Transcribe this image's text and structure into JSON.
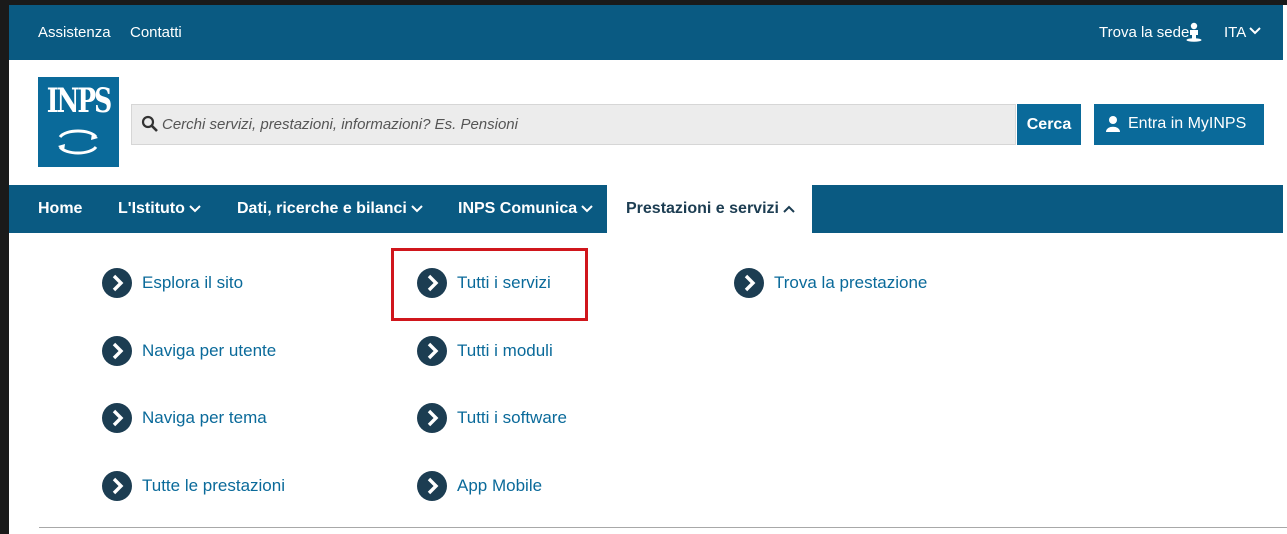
{
  "topbar": {
    "assistenza": "Assistenza",
    "contatti": "Contatti",
    "trova_sede": "Trova la sede",
    "lang": "ITA"
  },
  "header": {
    "logo_text": "INPS",
    "search_placeholder": "Cerchi servizi, prestazioni, informazioni? Es. Pensioni",
    "search_button": "Cerca",
    "login_button": "Entra in MyINPS"
  },
  "nav": {
    "home": "Home",
    "istituto": "L'Istituto",
    "dati": "Dati, ricerche e bilanci",
    "comunica": "INPS Comunica",
    "prestazioni": "Prestazioni e servizi"
  },
  "submenu": {
    "col1": [
      "Esplora il sito",
      "Naviga per utente",
      "Naviga per tema",
      "Tutte le prestazioni"
    ],
    "col2": [
      "Tutti i servizi",
      "Tutti i moduli",
      "Tutti i software",
      "App Mobile"
    ],
    "col3": [
      "Trova la prestazione"
    ]
  },
  "colors": {
    "brand": "#0a5a82",
    "accent": "#0a6a9a",
    "highlight": "#d0161c"
  },
  "icons": [
    "person-pin-icon",
    "chevron-down-icon",
    "search-icon",
    "user-icon",
    "chevron-up-icon",
    "chevron-right-circle-icon"
  ]
}
